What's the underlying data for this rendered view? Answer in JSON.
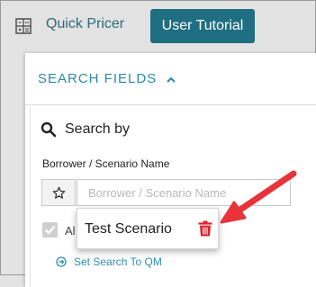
{
  "topbar": {
    "quick_pricer_label": "Quick Pricer",
    "quick_pricer_icon": "calculator-icon",
    "tutorial_button_label": "User Tutorial"
  },
  "search_fields": {
    "header": "SEARCH FIELDS",
    "collapse_icon": "chevron-up-icon",
    "search_by_label": "Search by",
    "name_field_label": "Borrower / Scenario Name",
    "name_field_placeholder": "Borrower / Scenario Name",
    "name_field_value": "",
    "favorite_icon": "star-icon",
    "checkbox_label_partial": "Al",
    "set_search_link": "Set Search To QM"
  },
  "dropdown": {
    "item_label": "Test Scenario",
    "delete_icon": "trash-icon"
  },
  "colors": {
    "accent_teal": "#1f6e82",
    "header_blue": "#2a8aa4",
    "delete_red": "#d9232e",
    "arrow_red": "#e8333b"
  }
}
